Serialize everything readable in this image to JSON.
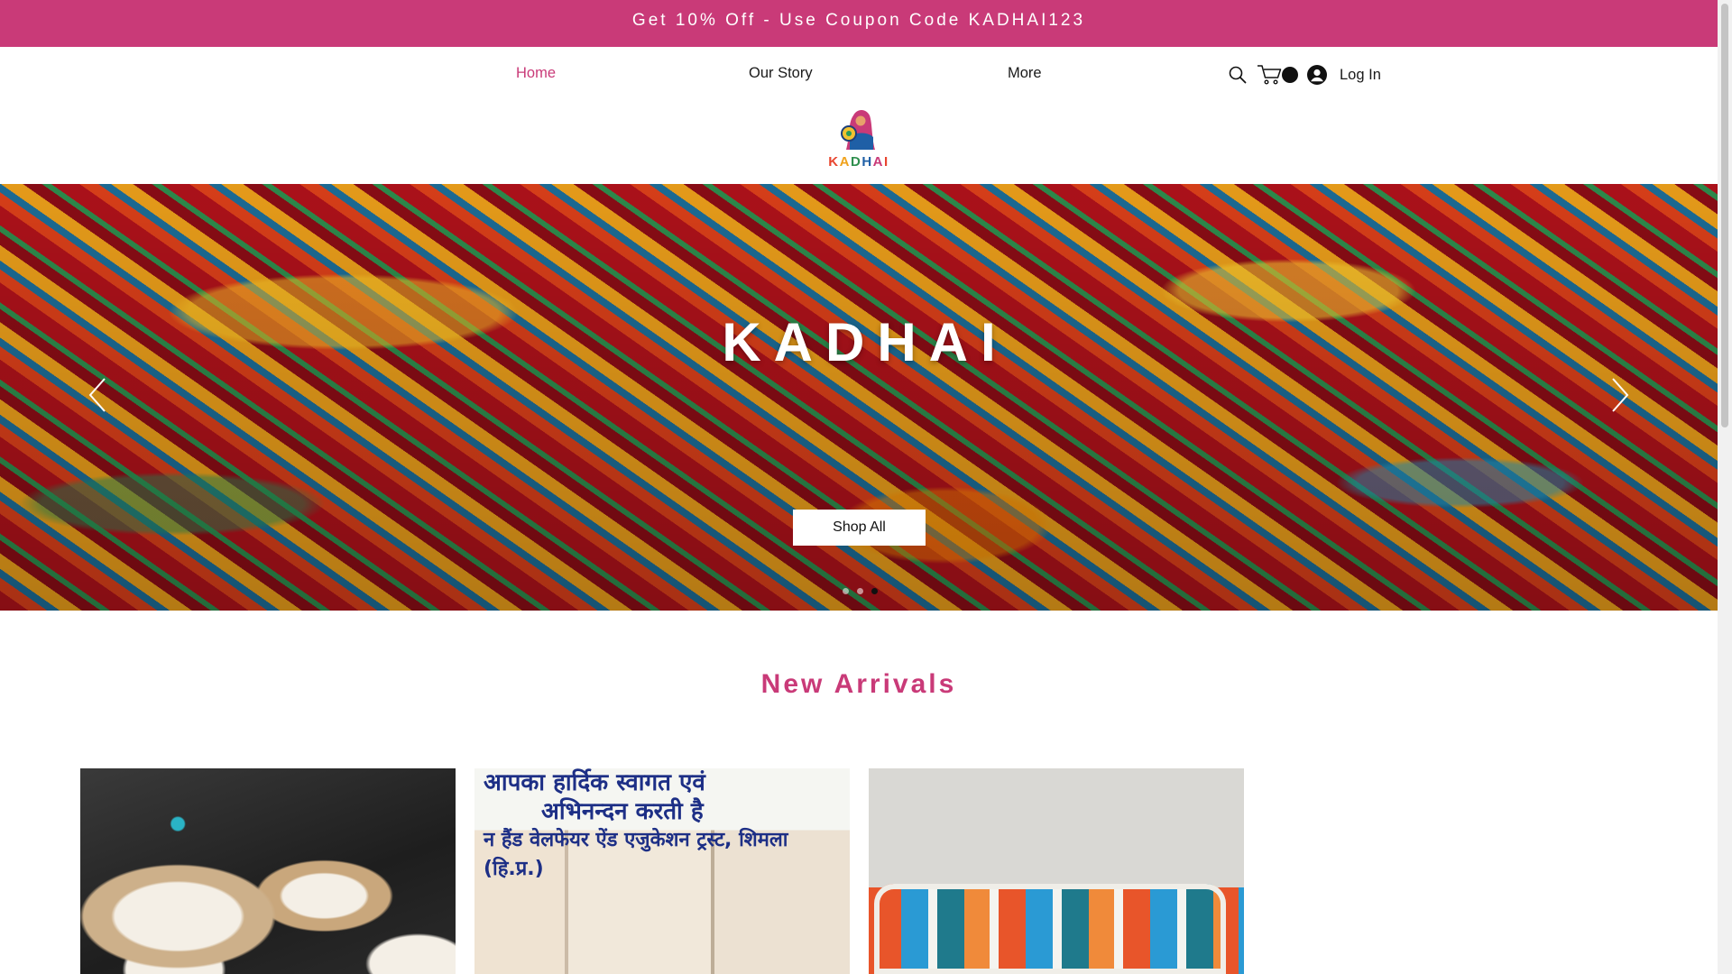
{
  "promo": {
    "text": "Get 10% Off - Use Coupon Code KADHAI123"
  },
  "nav": {
    "items": [
      {
        "label": "Home",
        "active": true
      },
      {
        "label": "Our Story",
        "active": false
      },
      {
        "label": "More",
        "active": false
      }
    ]
  },
  "header": {
    "search_icon": "search-icon",
    "cart_icon": "cart-icon",
    "cart_count": "",
    "login_label": "Log In",
    "login_icon": "user-avatar-icon",
    "logo_text": "KADHAI"
  },
  "hero": {
    "title": "KADHAI",
    "cta_label": "Shop All",
    "slide_count": 3,
    "active_slide": 3
  },
  "section": {
    "title": "New Arrivals"
  },
  "products": [
    {
      "image": "embroidered-jute-coasters"
    },
    {
      "image": "embroidered-tote-bags",
      "banner_lines": [
        "आपका हार्दिक स्वागत एवं",
        "अभिनन्दन करती है",
        "न हैंड वेलफेयर ऐंड एजुकेशन ट्रस्ट, शिमला (हि.प्र.)"
      ]
    },
    {
      "image": "crochet-pouch"
    }
  ],
  "colors": {
    "brand_pink": "#c93a78",
    "text_dark": "#1a1a1a",
    "white": "#ffffff"
  }
}
